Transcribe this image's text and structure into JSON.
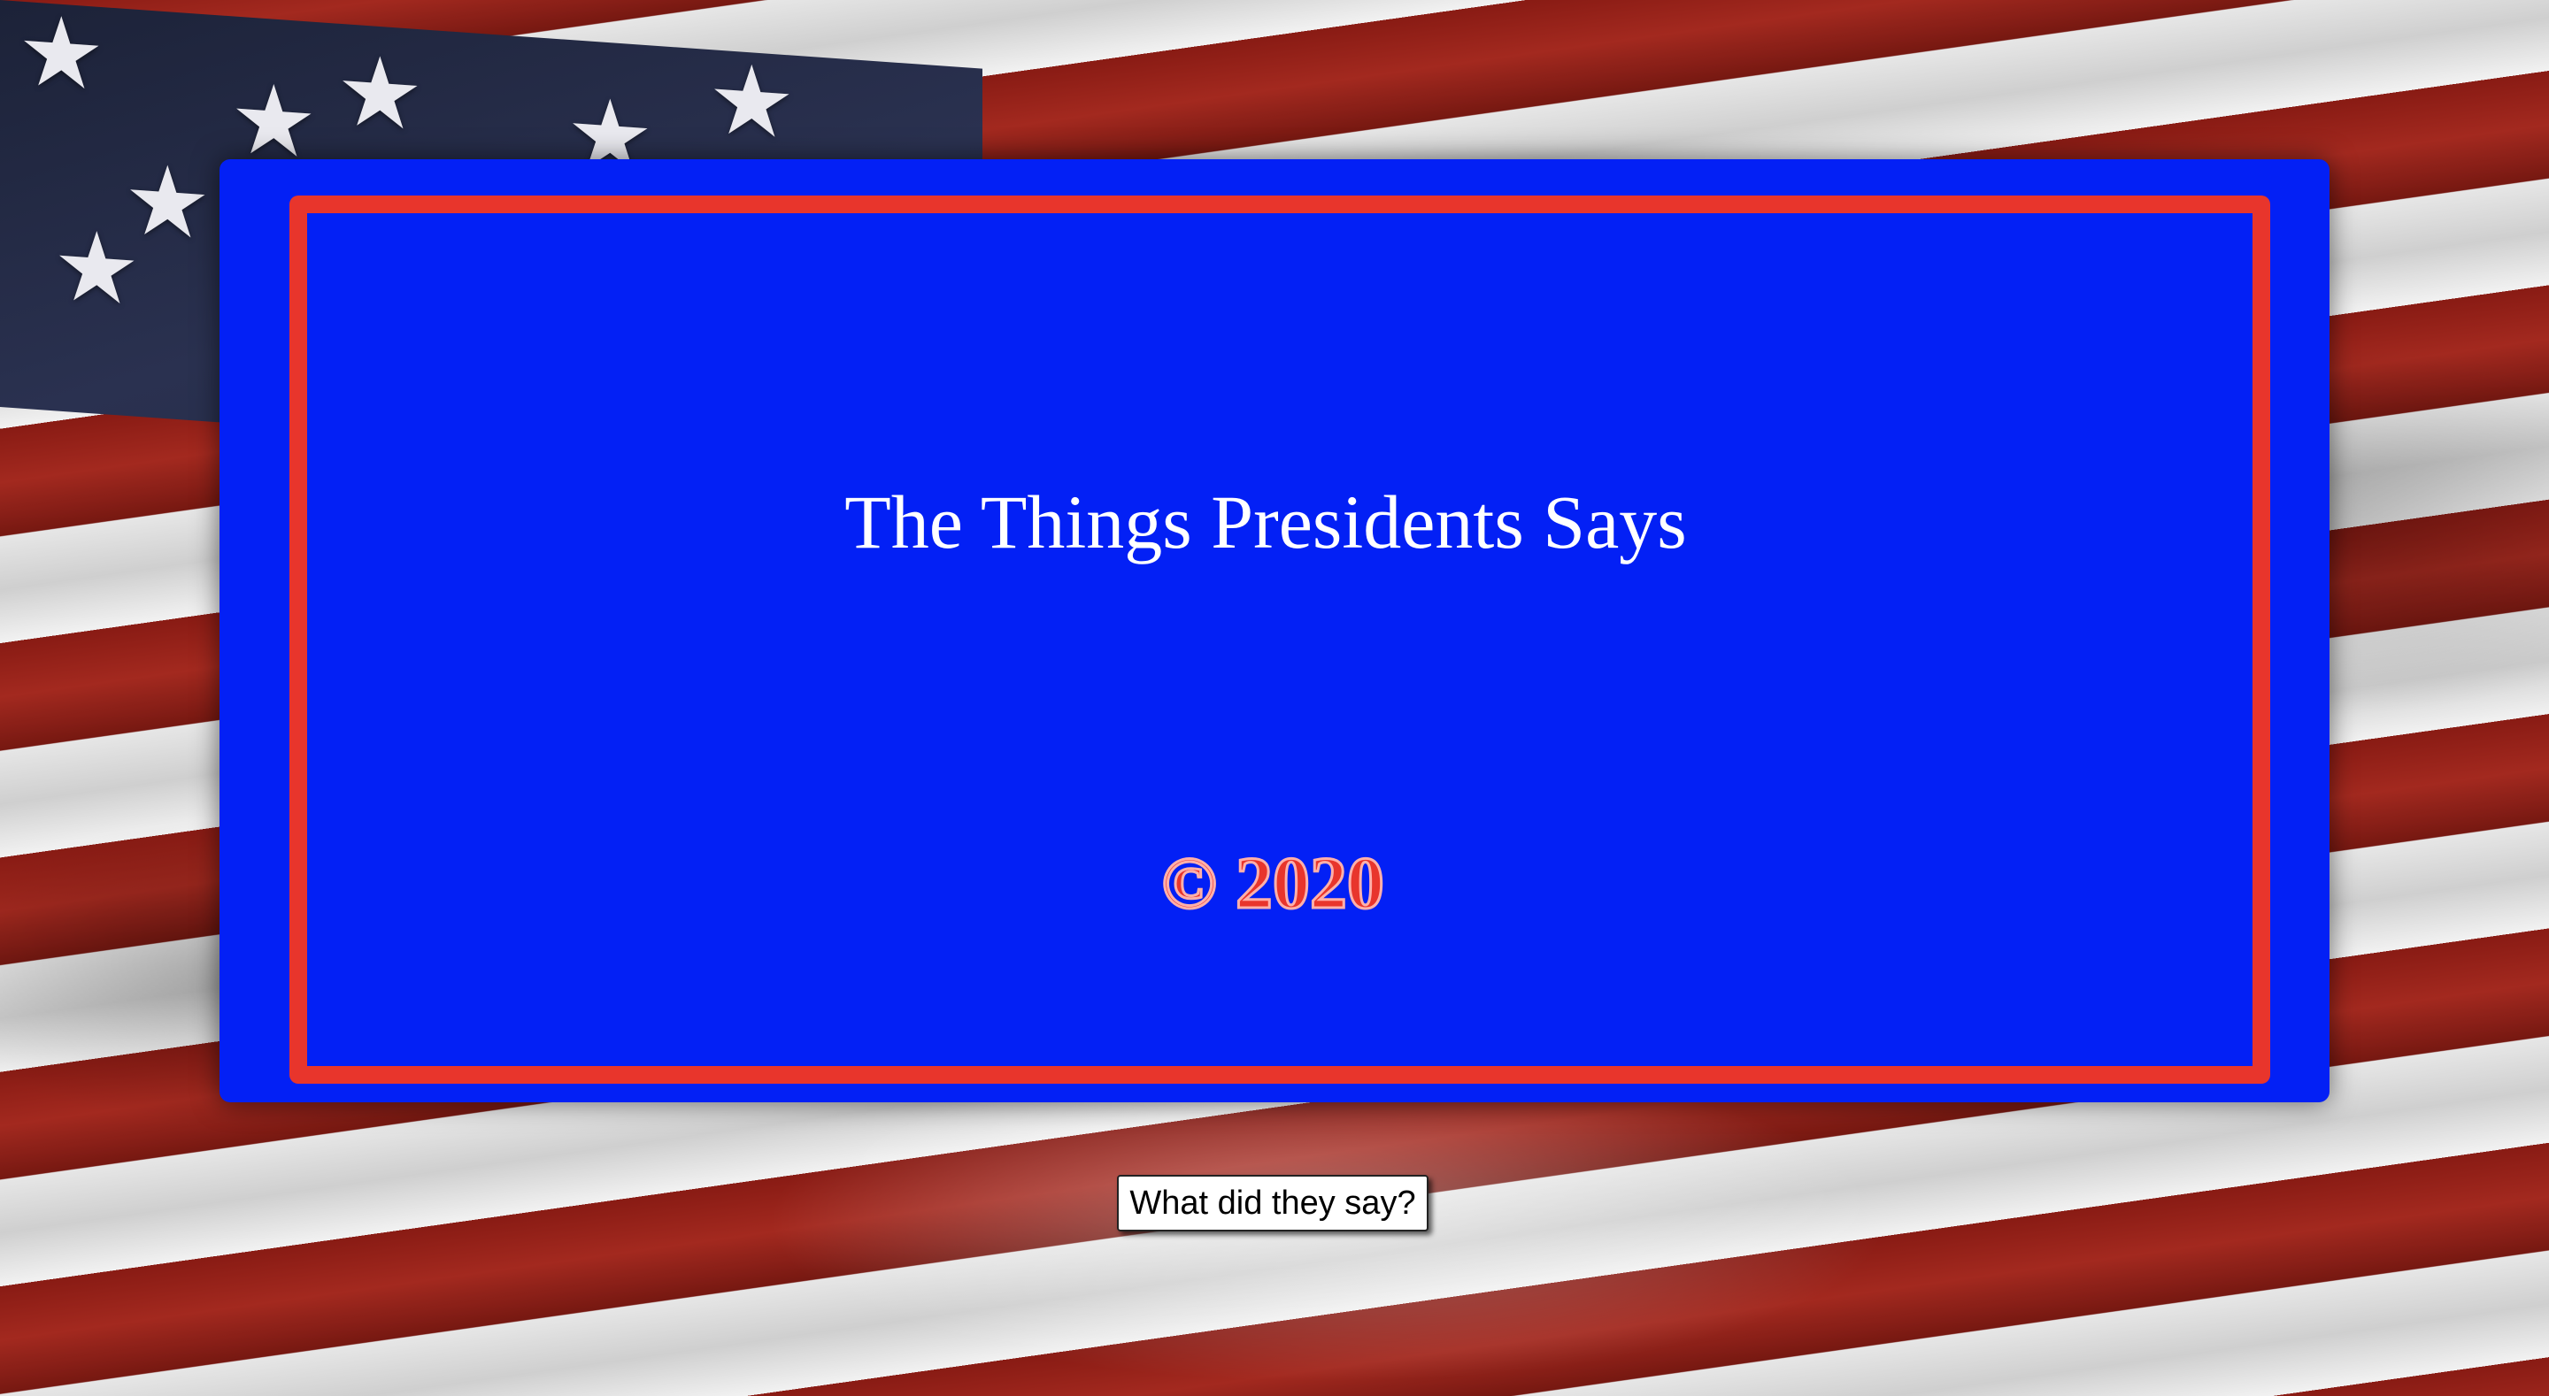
{
  "page": {
    "title": "The Things Presidents Says",
    "copyright": "© 2020",
    "button_label": "What did they say?"
  },
  "colors": {
    "card_background": "#0320f5",
    "card_border": "#e8352c",
    "title_text": "#ffffff",
    "copyright_text": "#e8352c"
  },
  "background": {
    "image": "american-flag"
  }
}
